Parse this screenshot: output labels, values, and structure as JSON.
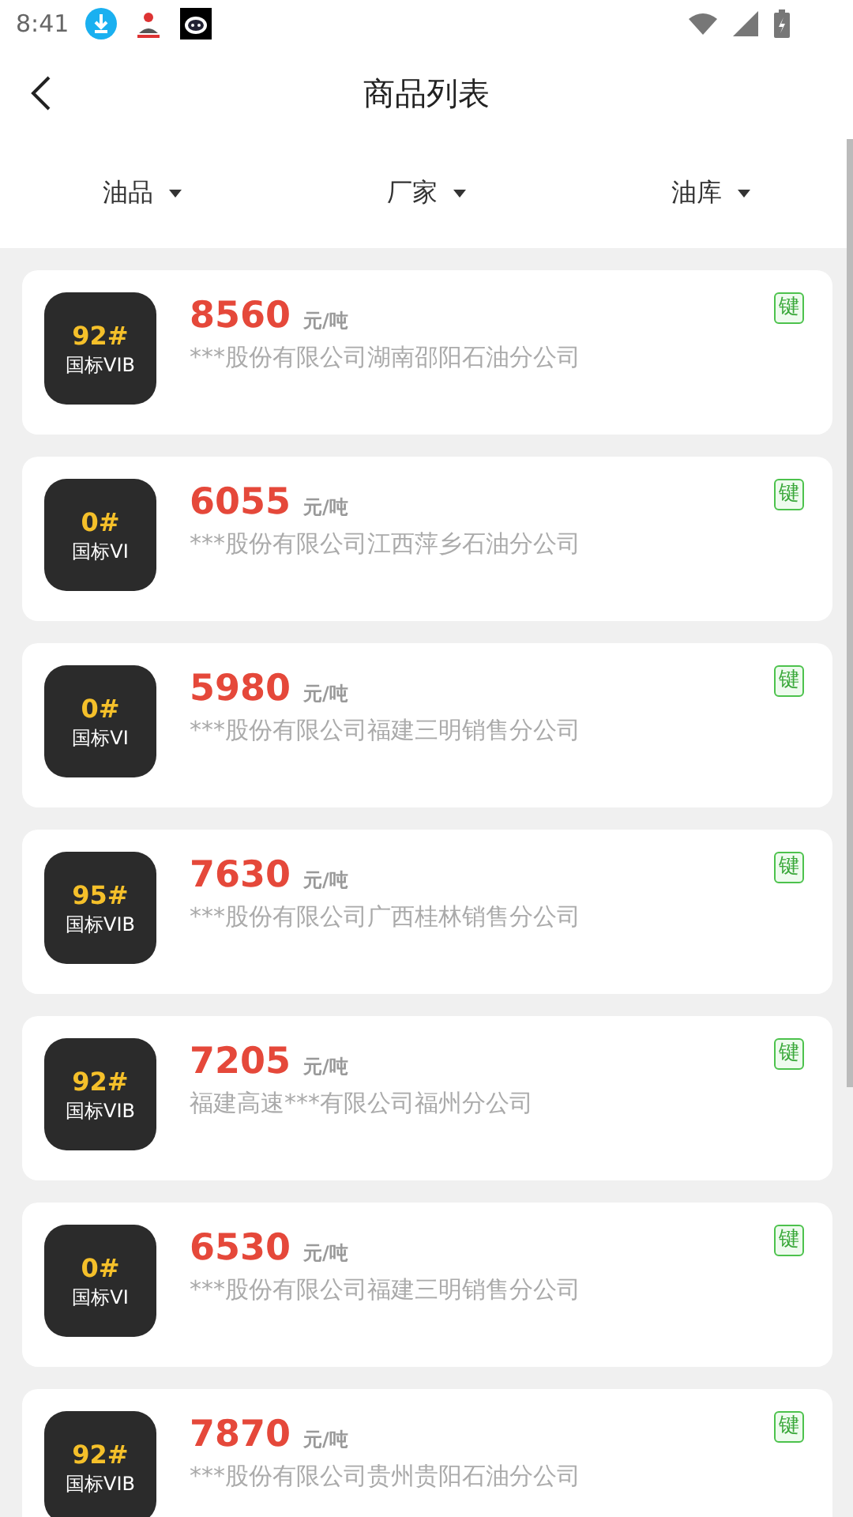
{
  "status_bar": {
    "time": "8:41"
  },
  "header": {
    "title": "商品列表"
  },
  "filters": [
    {
      "label": "油品"
    },
    {
      "label": "厂家"
    },
    {
      "label": "油库"
    }
  ],
  "products": [
    {
      "grade": "92#",
      "standard": "国标VIB",
      "price": "8560",
      "unit": "元/吨",
      "company": "***股份有限公司湖南邵阳石油分公司",
      "tag": "键"
    },
    {
      "grade": "0#",
      "standard": "国标VI",
      "price": "6055",
      "unit": "元/吨",
      "company": "***股份有限公司江西萍乡石油分公司",
      "tag": "键"
    },
    {
      "grade": "0#",
      "standard": "国标VI",
      "price": "5980",
      "unit": "元/吨",
      "company": "***股份有限公司福建三明销售分公司",
      "tag": "键"
    },
    {
      "grade": "95#",
      "standard": "国标VIB",
      "price": "7630",
      "unit": "元/吨",
      "company": "***股份有限公司广西桂林销售分公司",
      "tag": "键"
    },
    {
      "grade": "92#",
      "standard": "国标VIB",
      "price": "7205",
      "unit": "元/吨",
      "company": "福建高速***有限公司福州分公司",
      "tag": "键"
    },
    {
      "grade": "0#",
      "standard": "国标VI",
      "price": "6530",
      "unit": "元/吨",
      "company": "***股份有限公司福建三明销售分公司",
      "tag": "键"
    },
    {
      "grade": "92#",
      "standard": "国标VIB",
      "price": "7870",
      "unit": "元/吨",
      "company": "***股份有限公司贵州贵阳石油分公司",
      "tag": "键"
    }
  ]
}
